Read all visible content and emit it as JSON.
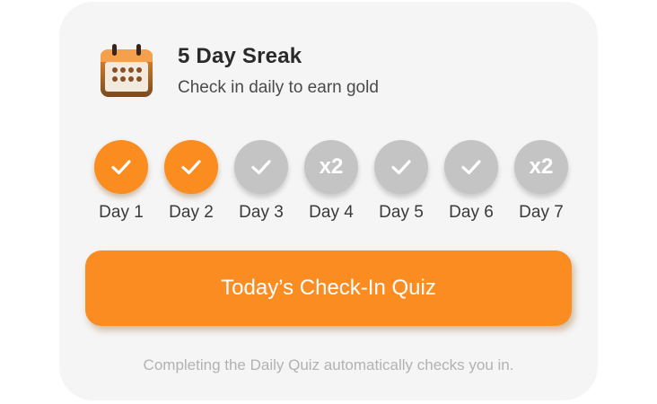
{
  "streak": {
    "title": "5 Day Sreak",
    "subtitle": "Check in daily to earn gold",
    "icon": "calendar-icon"
  },
  "days": [
    {
      "label": "Day 1",
      "state": "done",
      "badge": "",
      "icon": "check-icon"
    },
    {
      "label": "Day 2",
      "state": "done",
      "badge": "",
      "icon": "check-icon"
    },
    {
      "label": "Day 3",
      "state": "pending",
      "badge": "",
      "icon": "check-icon"
    },
    {
      "label": "Day 4",
      "state": "pending",
      "badge": "x2",
      "icon": ""
    },
    {
      "label": "Day 5",
      "state": "pending",
      "badge": "",
      "icon": "check-icon"
    },
    {
      "label": "Day 6",
      "state": "pending",
      "badge": "",
      "icon": "check-icon"
    },
    {
      "label": "Day 7",
      "state": "pending",
      "badge": "x2",
      "icon": ""
    }
  ],
  "cta": {
    "label": "Today’s Check-In Quiz"
  },
  "footnote": "Completing the Daily Quiz automatically checks you in.",
  "colors": {
    "accent": "#fb8c22",
    "done": "#fb8c1f",
    "pending": "#c4c4c4",
    "card_bg": "#f5f5f5"
  }
}
